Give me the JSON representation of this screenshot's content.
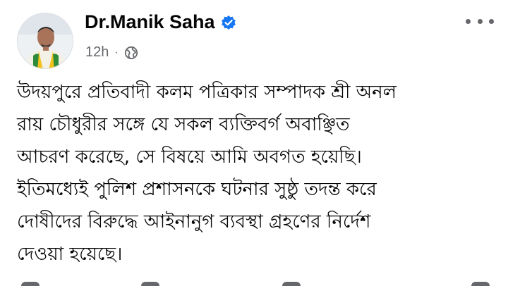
{
  "post": {
    "author": "Dr.Manik Saha",
    "verified_icon": "verified-badge-icon",
    "time": "12h",
    "separator": "·",
    "privacy_icon": "globe-icon",
    "more_icon": "more-options-icon",
    "text": "উদয়পুরে প্রতিবাদী কলম পত্রিকার সম্পাদক শ্রী অনল\nরায় চৌধুরীর সঙ্গে যে সকল ব্যক্তিবর্গ অবাঞ্ছিত\nআচরণ করেছে, সে বিষয়ে আমি অবগত হয়েছি।\nইতিমধ্যেই পুলিশ প্রশাসনকে ঘটনার সুষ্ঠু তদন্ত করে\nদোষীদের বিরুদ্ধে আইনানুগ ব্যবস্থা গ্রহণের নির্দেশ\nদেওয়া হয়েছে।"
  },
  "colors": {
    "accent": "#1877f2",
    "secondary_text": "#65676b",
    "primary_text": "#050505"
  }
}
